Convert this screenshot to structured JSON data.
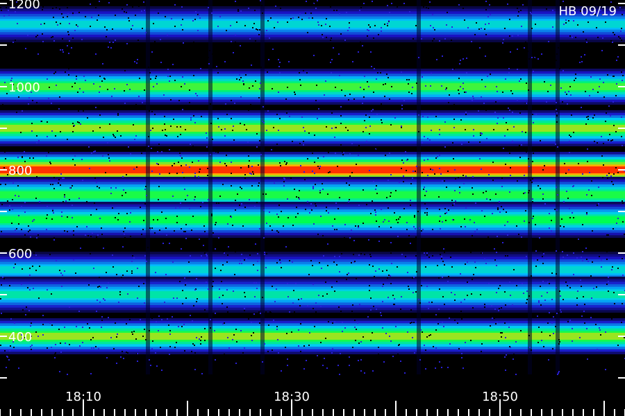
{
  "chart_data": {
    "type": "heatmap",
    "title": "HB 09/19",
    "xlabel": "",
    "ylabel": "",
    "x_tick_labels": [
      "18:10",
      "18:30",
      "18:50"
    ],
    "x_range_minutes": [
      "18:02",
      "19:02"
    ],
    "y_tick_labels": [
      "1200",
      "1000",
      "800",
      "600",
      "400"
    ],
    "ylim": [
      300,
      1200
    ],
    "colormap": [
      "#000000",
      "#1a14c8",
      "#00c8ff",
      "#00ff50",
      "#ffd200",
      "#ff2000"
    ],
    "series": [
      {
        "name": "band",
        "center": 1150,
        "peak_intensity": 0.45
      },
      {
        "name": "band",
        "center": 1000,
        "peak_intensity": 0.65
      },
      {
        "name": "band",
        "center": 900,
        "peak_intensity": 0.72
      },
      {
        "name": "band",
        "center": 800,
        "peak_intensity": 0.98
      },
      {
        "name": "band",
        "center": 740,
        "peak_intensity": 0.62
      },
      {
        "name": "band",
        "center": 680,
        "peak_intensity": 0.6
      },
      {
        "name": "band",
        "center": 560,
        "peak_intensity": 0.45
      },
      {
        "name": "band",
        "center": 500,
        "peak_intensity": 0.5
      },
      {
        "name": "band",
        "center": 400,
        "peak_intensity": 0.72
      }
    ]
  }
}
